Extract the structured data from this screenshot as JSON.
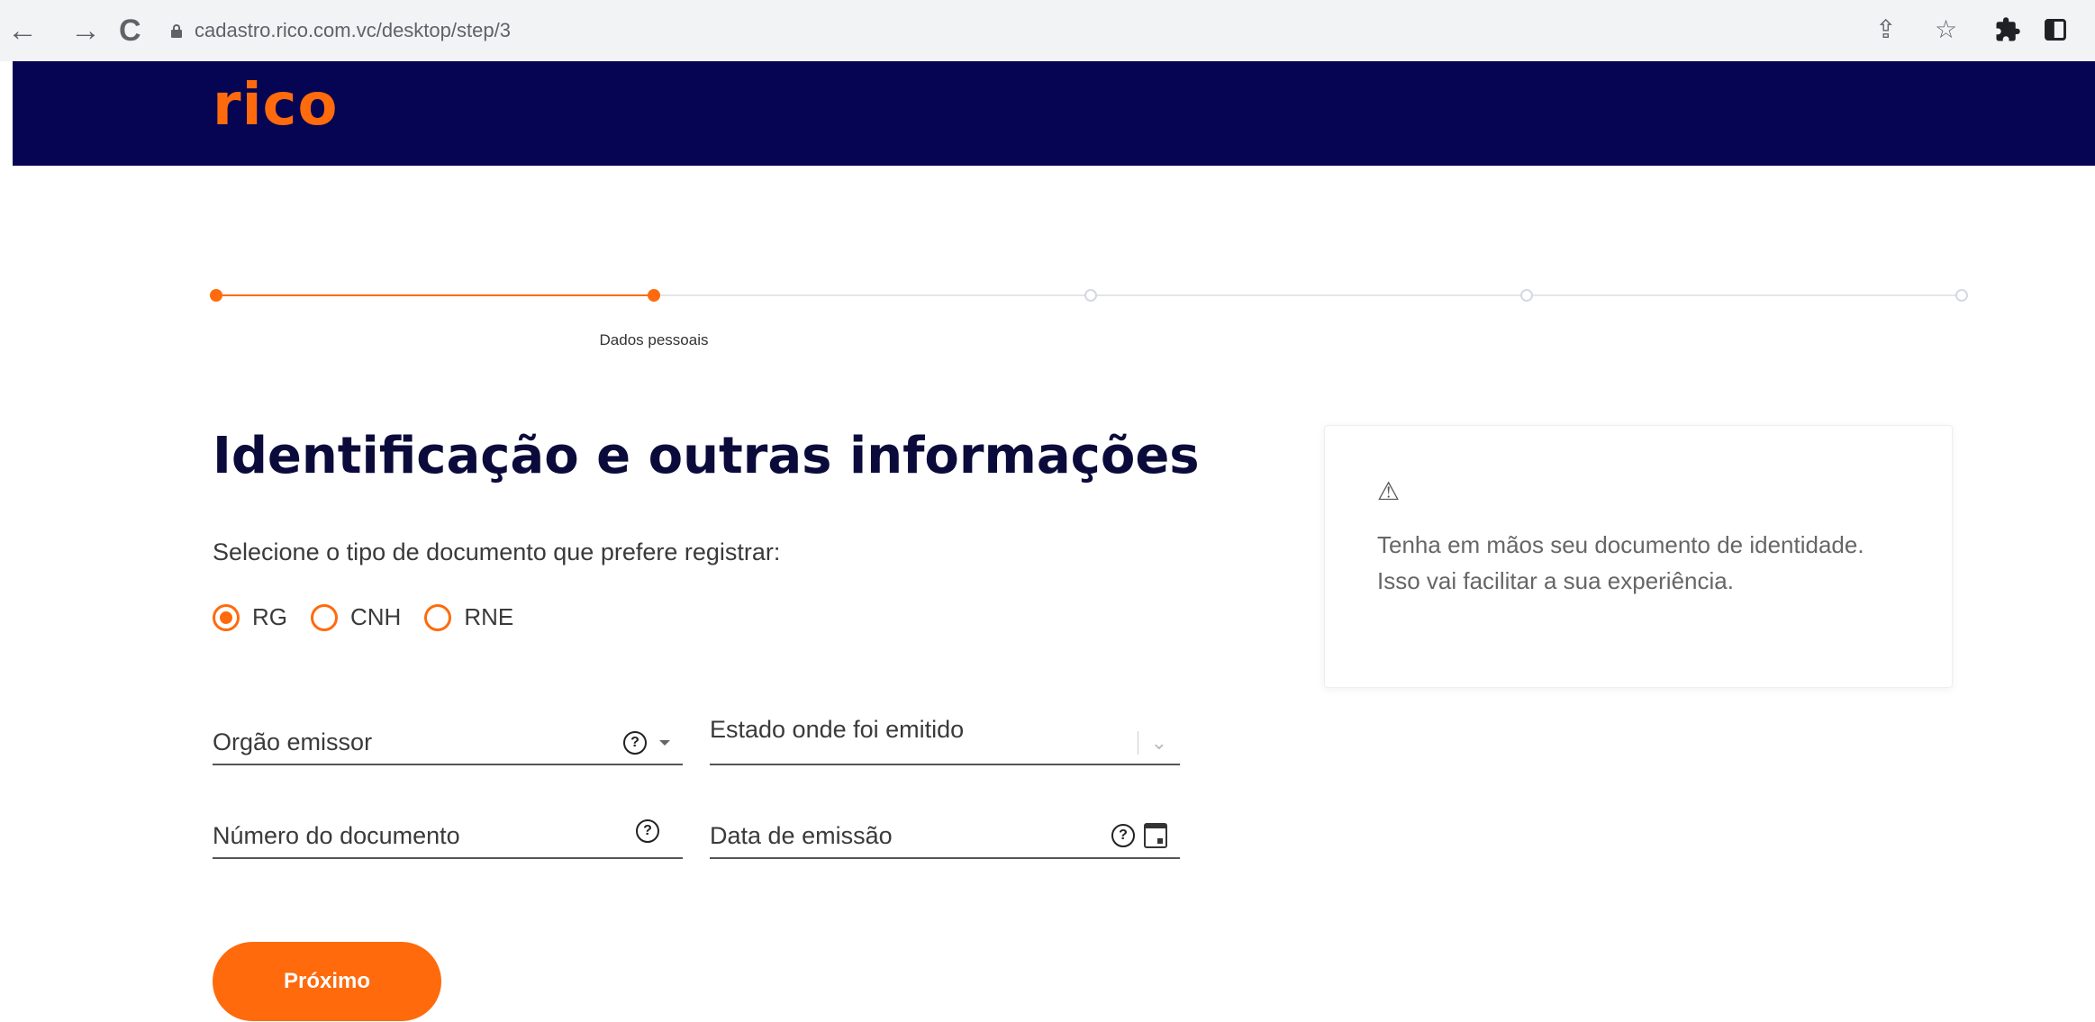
{
  "browser": {
    "url": "cadastro.rico.com.vc/desktop/step/3",
    "back_icon": "←",
    "forward_icon": "→",
    "reload_icon": "C",
    "share_icon": "⇪",
    "star_icon": "☆",
    "extensions_icon": "puzzle-icon",
    "sidebar_icon": "sidebar-icon"
  },
  "header": {
    "logo_text": "rico",
    "background_color": "#050553",
    "logo_color": "#ff6a0d"
  },
  "stepper": {
    "steps": [
      {
        "label": "",
        "state": "done"
      },
      {
        "label": "Dados pessoais",
        "state": "current"
      },
      {
        "label": "",
        "state": "todo"
      },
      {
        "label": "",
        "state": "todo"
      },
      {
        "label": "",
        "state": "todo"
      }
    ],
    "active_color": "#ff6a0d",
    "inactive_color": "#d5d8e0"
  },
  "main": {
    "title": "Identificação e outras informações",
    "subtitle": "Selecione o tipo de documento que prefere registrar:",
    "document_types": [
      {
        "label": "RG",
        "checked": true
      },
      {
        "label": "CNH",
        "checked": false
      },
      {
        "label": "RNE",
        "checked": false
      }
    ],
    "fields": {
      "orgao_emissor": {
        "label": "Orgão emissor",
        "help": "?"
      },
      "estado": {
        "label": "Estado onde foi emitido",
        "chevron": "⌄"
      },
      "numero_documento": {
        "label": "Número do documento",
        "help": "?"
      },
      "data_emissao": {
        "label": "Data de emissão",
        "help": "?"
      }
    },
    "next_button_label": "Próximo",
    "accent_color": "#ff6a0d"
  },
  "info_card": {
    "icon": "⚠",
    "text": "Tenha em mãos seu documento de identidade. Isso vai facilitar a sua experiência."
  }
}
